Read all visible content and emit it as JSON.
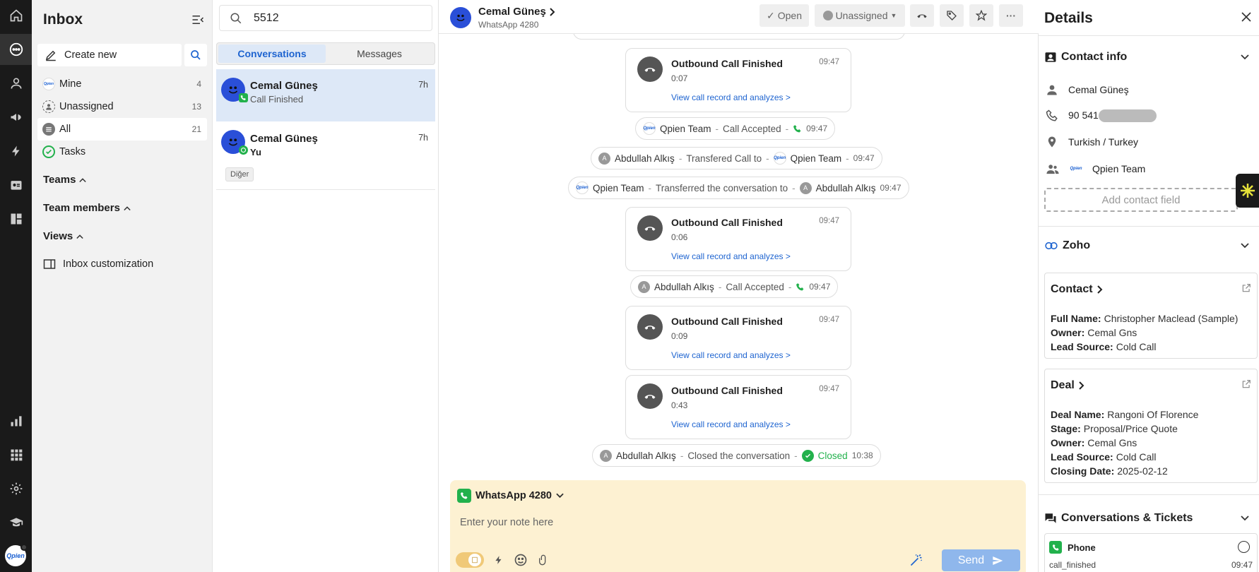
{
  "sidebar": {
    "title": "Inbox",
    "create_new": "Create new",
    "nav": [
      {
        "label": "Mine",
        "count": "4"
      },
      {
        "label": "Unassigned",
        "count": "13"
      },
      {
        "label": "All",
        "count": "21"
      },
      {
        "label": "Tasks",
        "count": ""
      }
    ],
    "sections": [
      "Teams",
      "Team members",
      "Views"
    ],
    "inbox_customization": "Inbox customization",
    "brand": "Qpien"
  },
  "convlist": {
    "search_value": "5512",
    "tabs": [
      "Conversations",
      "Messages"
    ],
    "items": [
      {
        "name": "Cemal Güneş",
        "time": "7h",
        "sub": "Call Finished",
        "channel": "phone"
      },
      {
        "name": "Cemal Güneş",
        "time": "7h",
        "sub": "Yu",
        "channel": "whatsapp",
        "tag": "Diğer"
      }
    ]
  },
  "chat": {
    "contact_name": "Cemal Güneş",
    "channel": "WhatsApp 4280",
    "status_label": "Open",
    "assign_label": "Unassigned",
    "calls": [
      {
        "title": "Outbound Call Finished",
        "time": "09:47",
        "duration": "0:07",
        "link": "View call record and analyzes >"
      },
      {
        "title": "Outbound Call Finished",
        "time": "09:47",
        "duration": "0:06",
        "link": "View call record and analyzes >"
      },
      {
        "title": "Outbound Call Finished",
        "time": "09:47",
        "duration": "0:09",
        "link": "View call record and analyzes >"
      },
      {
        "title": "Outbound Call Finished",
        "time": "09:47",
        "duration": "0:43",
        "link": "View call record and analyzes >"
      }
    ],
    "events": {
      "e1": {
        "actor": "Qpien Team",
        "action": "Call Accepted",
        "time": "09:47"
      },
      "e2": {
        "actor": "Abdullah Alkış",
        "action": "Transfered Call to",
        "target": "Qpien Team",
        "time": "09:47"
      },
      "e3": {
        "actor": "Qpien Team",
        "action": "Transferred the conversation to",
        "target": "Abdullah Alkış",
        "time": "09:47"
      },
      "e4": {
        "actor": "Abdullah Alkış",
        "action": "Call Accepted",
        "time": "09:47"
      },
      "e5": {
        "actor": "Abdullah Alkış",
        "action": "Closed the conversation",
        "status": "Closed",
        "time": "10:38"
      }
    },
    "composer": {
      "channel": "WhatsApp 4280",
      "placeholder": "Enter your note here",
      "send": "Send"
    }
  },
  "details": {
    "title": "Details",
    "contact_info": {
      "heading": "Contact info",
      "name": "Cemal Güneş",
      "phone_prefix": "90 541",
      "language": "Turkish / Turkey",
      "team": "Qpien Team",
      "add_field": "Add contact field"
    },
    "zoho": {
      "heading": "Zoho",
      "contact": {
        "heading": "Contact",
        "fields": [
          {
            "label": "Full Name:",
            "value": "Christopher Maclead (Sample)"
          },
          {
            "label": "Owner:",
            "value": "Cemal Gns"
          },
          {
            "label": "Lead Source:",
            "value": "Cold Call"
          }
        ]
      },
      "deal": {
        "heading": "Deal",
        "fields": [
          {
            "label": "Deal Name:",
            "value": "Rangoni Of Florence"
          },
          {
            "label": "Stage:",
            "value": "Proposal/Price Quote"
          },
          {
            "label": "Owner:",
            "value": "Cemal Gns"
          },
          {
            "label": "Lead Source:",
            "value": "Cold Call"
          },
          {
            "label": "Closing Date:",
            "value": "2025-02-12"
          }
        ]
      }
    },
    "tickets": {
      "heading": "Conversations & Tickets",
      "item": {
        "channel": "Phone",
        "status": "call_finished",
        "time": "09:47"
      }
    }
  },
  "colors": {
    "accent": "#1e64d0",
    "whatsapp_green": "#22b14c",
    "avatar_blue": "#2a4fd8",
    "composer_bg": "#fdf1d2"
  }
}
